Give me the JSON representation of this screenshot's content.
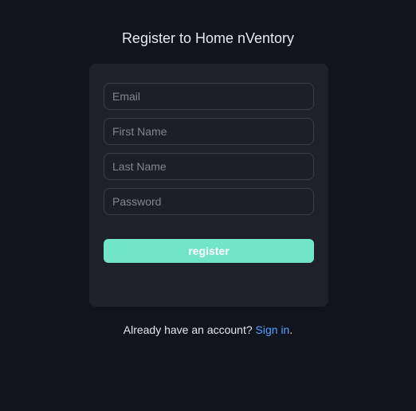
{
  "header": {
    "title": "Register to Home nVentory"
  },
  "form": {
    "email_placeholder": "Email",
    "first_name_placeholder": "First Name",
    "last_name_placeholder": "Last Name",
    "password_placeholder": "Password",
    "submit_label": "register"
  },
  "footer": {
    "prompt": "Already have an account?",
    "link_label": "Sign in",
    "suffix": "."
  },
  "colors": {
    "background": "#12141d",
    "card": "#1e2129",
    "accent": "#72e5c8",
    "link": "#4aa3ff"
  }
}
